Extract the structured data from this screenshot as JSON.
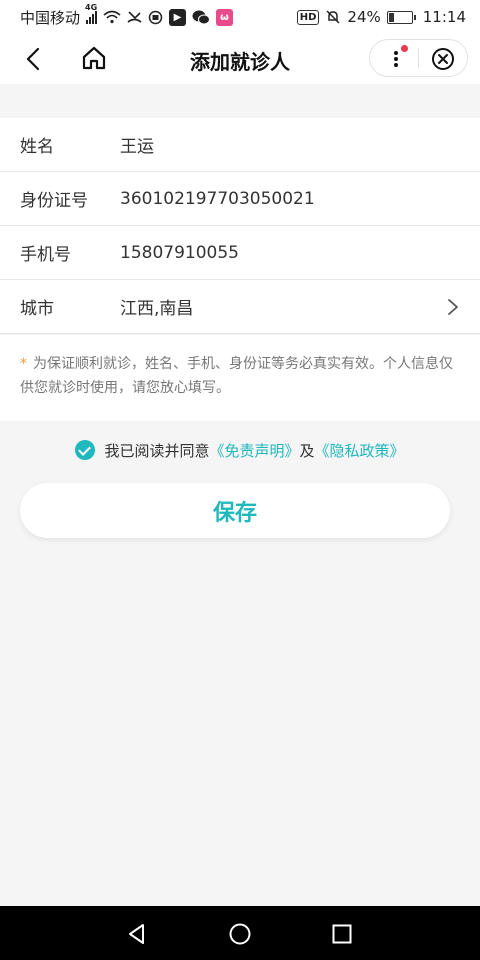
{
  "status_bar": {
    "carrier": "中国移动",
    "network": "4G",
    "hd": "HD",
    "battery": "24%",
    "battery_level": 0.24,
    "time": "11:14"
  },
  "nav": {
    "title": "添加就诊人"
  },
  "form": {
    "rows": [
      {
        "label": "姓名",
        "value": "王运"
      },
      {
        "label": "身份证号",
        "value": "360102197703050021"
      },
      {
        "label": "手机号",
        "value": "15807910055"
      },
      {
        "label": "城市",
        "value": "江西,南昌"
      }
    ],
    "notice_star": "*",
    "notice": "为保证顺利就诊，姓名、手机、身份证等务必真实有效。个人信息仅供您就诊时使用，请您放心填写。"
  },
  "agreement": {
    "checked": true,
    "prefix": "我已阅读并同意",
    "link1": "《免责声明》",
    "connector": "及",
    "link2": "《隐私政策》"
  },
  "actions": {
    "save_label": "保存"
  },
  "colors": {
    "accent": "#1fb8bd",
    "star": "#f29c38",
    "badge_red": "#e8384f"
  }
}
